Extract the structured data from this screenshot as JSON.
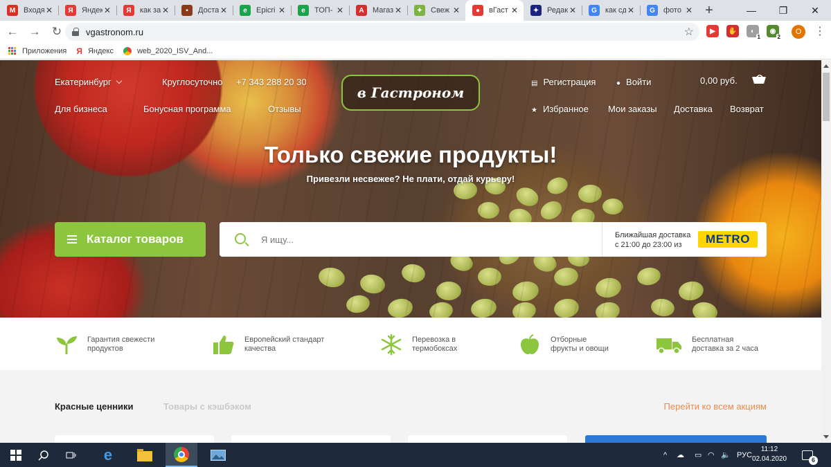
{
  "browser": {
    "tabs": [
      {
        "title": "Входя",
        "fav": "M",
        "color": "#d93025"
      },
      {
        "title": "Яндек",
        "fav": "Я",
        "color": "#e53935"
      },
      {
        "title": "как за",
        "fav": "Я",
        "color": "#e53935"
      },
      {
        "title": "Доста",
        "fav": "▪",
        "color": "#8a3b1a"
      },
      {
        "title": "Epicri",
        "fav": "e",
        "color": "#1aa34a"
      },
      {
        "title": "ТОП-",
        "fav": "e",
        "color": "#1aa34a"
      },
      {
        "title": "Магаз",
        "fav": "A",
        "color": "#d32f2f"
      },
      {
        "title": "Свеж",
        "fav": "✦",
        "color": "#7cb342"
      },
      {
        "title": "вГаст",
        "fav": "●",
        "color": "#e53935",
        "active": true
      },
      {
        "title": "Редак",
        "fav": "✦",
        "color": "#1a237e"
      },
      {
        "title": "как сд",
        "fav": "G",
        "color": "#4285f4"
      },
      {
        "title": "фото",
        "fav": "G",
        "color": "#4285f4"
      }
    ],
    "new_tab": "+",
    "url": "vgastronom.ru",
    "bookmarks": [
      {
        "label": "Приложения"
      },
      {
        "label": "Яндекс"
      },
      {
        "label": "web_2020_ISV_And..."
      }
    ],
    "extensions": [
      {
        "icon": "▶",
        "color": "#e53935",
        "badge": ""
      },
      {
        "icon": "✋",
        "color": "#d32f2f",
        "badge": ""
      },
      {
        "icon": "◐",
        "color": "#9e9e9e",
        "badge": "1"
      },
      {
        "icon": "◉",
        "color": "#558b2f",
        "badge": "2"
      }
    ],
    "profile_letter": "O"
  },
  "header": {
    "city": "Екатеринбург",
    "hours": "Круглосуточно",
    "phone": "+7 343 288 20 30",
    "logo": "в Гастроном",
    "register": "Регистрация",
    "login": "Войти",
    "cart_total": "0,00 руб.",
    "nav_left": [
      "Для бизнеса",
      "Бонусная программа",
      "Отзывы"
    ],
    "favorites": "Избранное",
    "nav_right": [
      "Мои заказы",
      "Доставка",
      "Возврат"
    ]
  },
  "hero": {
    "title": "Только свежие продукты!",
    "subtitle": "Привезли несвежее? Не плати, отдай курьеру!"
  },
  "search": {
    "catalog_label": "Каталог товаров",
    "placeholder": "Я ищу...",
    "delivery_line1": "Ближайшая доставка",
    "delivery_line2": "с 21:00 до 23:00 из",
    "partner": "METRO"
  },
  "features": [
    {
      "icon": "sprout-icon",
      "text": "Гарантия свежести\nпродуктов"
    },
    {
      "icon": "thumbs-up-icon",
      "text": "Европейский стандарт\nкачества"
    },
    {
      "icon": "snowflake-icon",
      "text": "Перевозка в\nтермобоксах"
    },
    {
      "icon": "apple-icon",
      "text": "Отборные\nфрукты и овощи"
    },
    {
      "icon": "delivery-truck-icon",
      "text": "Бесплатная\nдоставка за 2 часа"
    }
  ],
  "promos": {
    "tab_active": "Красные ценники",
    "tab_inactive": "Товары с кэшбэком",
    "all_link": "Перейти ко всем акциям"
  },
  "colors": {
    "accent": "#8cc63f",
    "promo_link": "#f08a4b",
    "metro_yellow": "#ffd500",
    "metro_blue": "#0b3a8c"
  },
  "taskbar": {
    "language": "РУС",
    "time": "11:12",
    "date": "02.04.2020",
    "notifications": "6"
  }
}
